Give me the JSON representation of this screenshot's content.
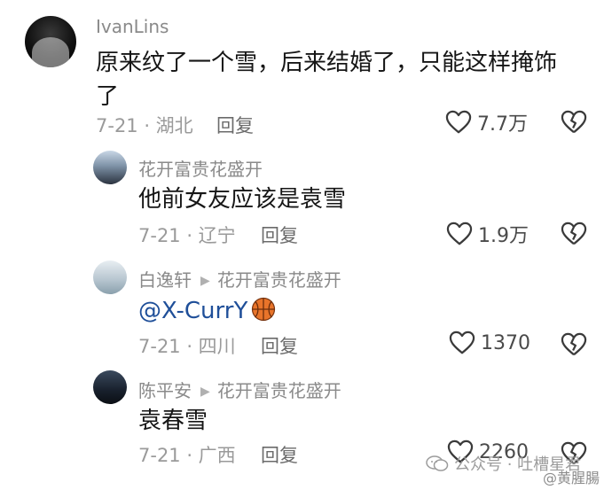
{
  "comments": [
    {
      "username": "IvanLins",
      "text_line1": "原来纹了一个雪，后来结婚了，只能这样掩饰",
      "text_line2": "了",
      "meta": "7-21 · 湖北",
      "reply_label": "回复",
      "likes": "7.7万"
    },
    {
      "username": "花开富贵花盛开",
      "text": "他前女友应该是袁雪",
      "meta": "7-21 · 辽宁",
      "reply_label": "回复",
      "likes": "1.9万"
    },
    {
      "username": "白逸轩",
      "reply_to": "花开富贵花盛开",
      "text": "@X-CurrY",
      "meta": "7-21 · 四川",
      "reply_label": "回复",
      "likes": "1370"
    },
    {
      "username": "陈平安",
      "reply_to": "花开富贵花盛开",
      "text": "袁春雪",
      "meta": "7-21 · 广西",
      "reply_label": "回复",
      "likes": "2260"
    }
  ],
  "watermark": {
    "account": "公众号 · 吐槽星君",
    "weibo_user": "@黄腥腸"
  },
  "icons": {
    "like": "heart-outline-icon",
    "dislike": "broken-heart-icon",
    "reply_to": "triangle-right-icon",
    "emoji": "basketball-icon",
    "watermark_logo": "wechat-icon"
  }
}
